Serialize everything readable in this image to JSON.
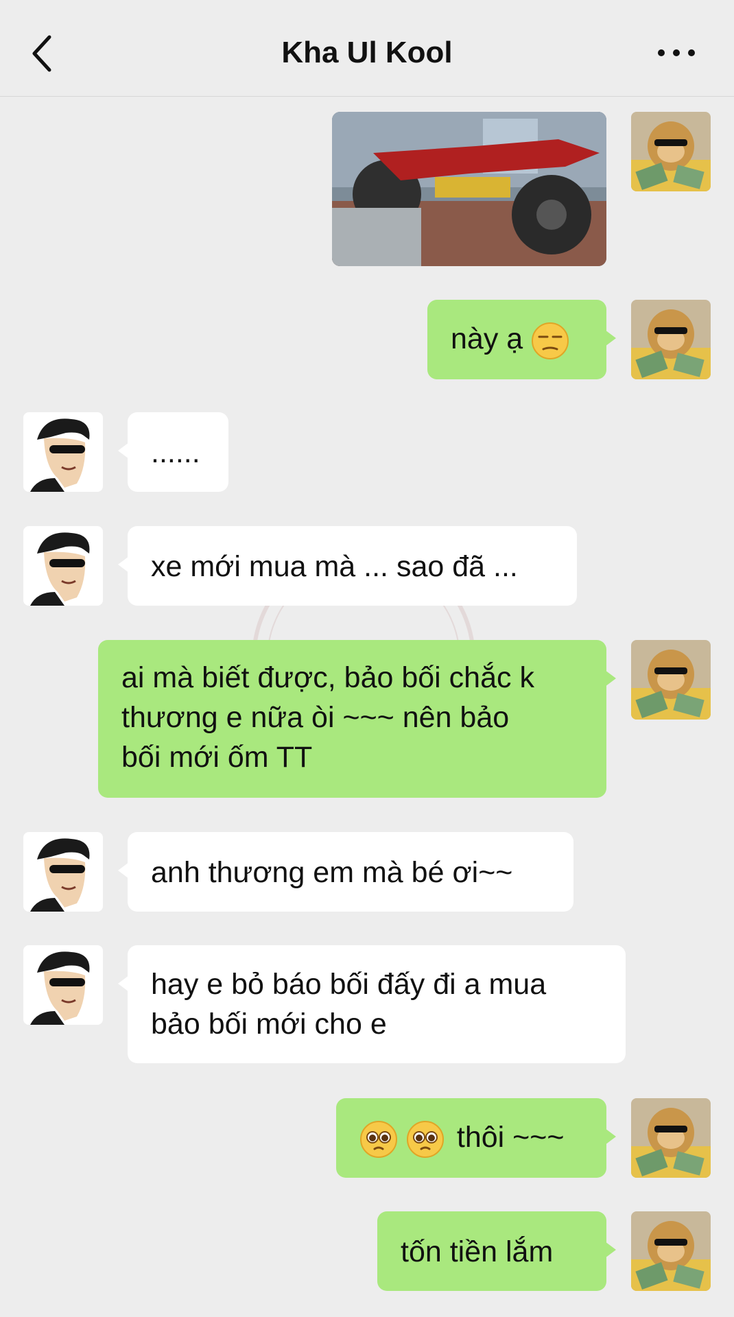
{
  "header": {
    "title": "Kha Ul Kool",
    "back_icon": "chevron-left-icon",
    "more_icon": "more-dots-icon"
  },
  "messages": [
    {
      "from": "me",
      "type": "image",
      "image": "motorcycle-photo"
    },
    {
      "from": "me",
      "text": "này ạ",
      "emoji": "unamused-face"
    },
    {
      "from": "other",
      "text": "......"
    },
    {
      "from": "other",
      "text": "xe mới mua mà ... sao đã ..."
    },
    {
      "from": "me",
      "lines": [
        "ai mà biết được, bảo bối chắc k",
        "thương e nữa òi ~~~ nên bảo",
        "bối mới ốm TT"
      ]
    },
    {
      "from": "other",
      "text": "anh thương em mà bé ơi~~"
    },
    {
      "from": "other",
      "lines": [
        "hay e bỏ báo bối đấy đi a mua",
        "bảo bối mới cho e"
      ]
    },
    {
      "from": "me",
      "text": "thôi ~~~",
      "emoji": "pleading-face"
    },
    {
      "from": "me",
      "text": "tốn tiền lắm"
    }
  ],
  "colors": {
    "sent_bubble": "#a9e87e",
    "received_bubble": "#ffffff",
    "background": "#ededed"
  }
}
